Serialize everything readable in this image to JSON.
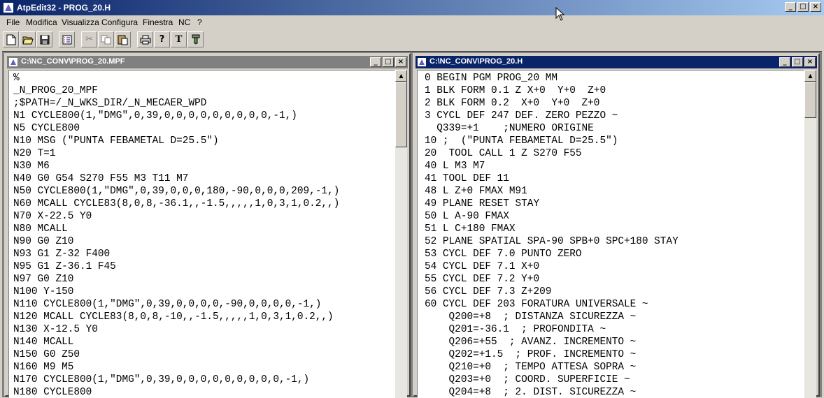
{
  "app": {
    "title": "AtpEdit32 - PROG_20.H"
  },
  "menu": [
    "File",
    "Modifica",
    "Visualizza",
    "Configura",
    "Finestra",
    "NC",
    "?"
  ],
  "toolbar": {
    "new_icon": "new-document-icon",
    "open_icon": "open-folder-icon",
    "save_icon": "save-disk-icon",
    "list_icon": "list-icon",
    "cut_icon": "scissors-icon",
    "copy_icon": "copy-icon",
    "paste_icon": "paste-icon",
    "print_icon": "printer-icon",
    "help_icon": "help-icon",
    "text_label": "T",
    "tool_icon": "tool-icon"
  },
  "colors": {
    "active_title": "#0a246a",
    "inactive_title": "#808080"
  },
  "left": {
    "title": "C:\\NC_CONV\\PROG_20.MPF",
    "lines": [
      "%",
      "_N_PROG_20_MPF",
      ";$PATH=/_N_WKS_DIR/_N_MECAER_WPD",
      "N1 CYCLE800(1,\"DMG\",0,39,0,0,0,0,0,0,0,0,0,-1,)",
      "N5 CYCLE800",
      "N10 MSG (\"PUNTA FEBAMETAL D=25.5\")",
      "N20 T=1",
      "N30 M6",
      "N40 G0 G54 S270 F55 M3 T11 M7",
      "N50 CYCLE800(1,\"DMG\",0,39,0,0,0,180,-90,0,0,0,209,-1,)",
      "N60 MCALL CYCLE83(8,0,8,-36.1,,-1.5,,,,,1,0,3,1,0.2,,)",
      "N70 X-22.5 Y0",
      "N80 MCALL",
      "N90 G0 Z10",
      "N93 G1 Z-32 F400",
      "N95 G1 Z-36.1 F45",
      "N97 G0 Z10",
      "N100 Y-150",
      "N110 CYCLE800(1,\"DMG\",0,39,0,0,0,0,-90,0,0,0,0,-1,)",
      "N120 MCALL CYCLE83(8,0,8,-10,,-1.5,,,,,1,0,3,1,0.2,,)",
      "N130 X-12.5 Y0",
      "N140 MCALL",
      "N150 G0 Z50",
      "N160 M9 M5",
      "N170 CYCLE800(1,\"DMG\",0,39,0,0,0,0,0,0,0,0,0,-1,)",
      "N180 CYCLE800"
    ]
  },
  "right": {
    "title": "C:\\NC_CONV\\PROG_20.H",
    "lines": [
      "0 BEGIN PGM PROG_20 MM",
      "1 BLK FORM 0.1 Z X+0  Y+0  Z+0",
      "2 BLK FORM 0.2  X+0  Y+0  Z+0",
      "3 CYCL DEF 247 DEF. ZERO PEZZO ~",
      "  Q339=+1    ;NUMERO ORIGINE",
      "10 ;  (\"PUNTA FEBAMETAL D=25.5\")",
      "20  TOOL CALL 1 Z S270 F55",
      "40 L M3 M7",
      "41 TOOL DEF 11",
      "48 L Z+0 FMAX M91",
      "49 PLANE RESET STAY",
      "50 L A-90 FMAX",
      "51 L C+180 FMAX",
      "52 PLANE SPATIAL SPA-90 SPB+0 SPC+180 STAY",
      "53 CYCL DEF 7.0 PUNTO ZERO",
      "54 CYCL DEF 7.1 X+0",
      "55 CYCL DEF 7.2 Y+0",
      "56 CYCL DEF 7.3 Z+209",
      "60 CYCL DEF 203 FORATURA UNIVERSALE ~",
      "    Q200=+8  ; DISTANZA SICUREZZA ~",
      "    Q201=-36.1  ; PROFONDITA ~",
      "    Q206=+55  ; AVANZ. INCREMENTO ~",
      "    Q202=+1.5  ; PROF. INCREMENTO ~",
      "    Q210=+0  ; TEMPO ATTESA SOPRA ~",
      "    Q203=+0  ; COORD. SUPERFICIE ~",
      "    Q204=+8  ; 2. DIST. SICUREZZA ~"
    ]
  }
}
